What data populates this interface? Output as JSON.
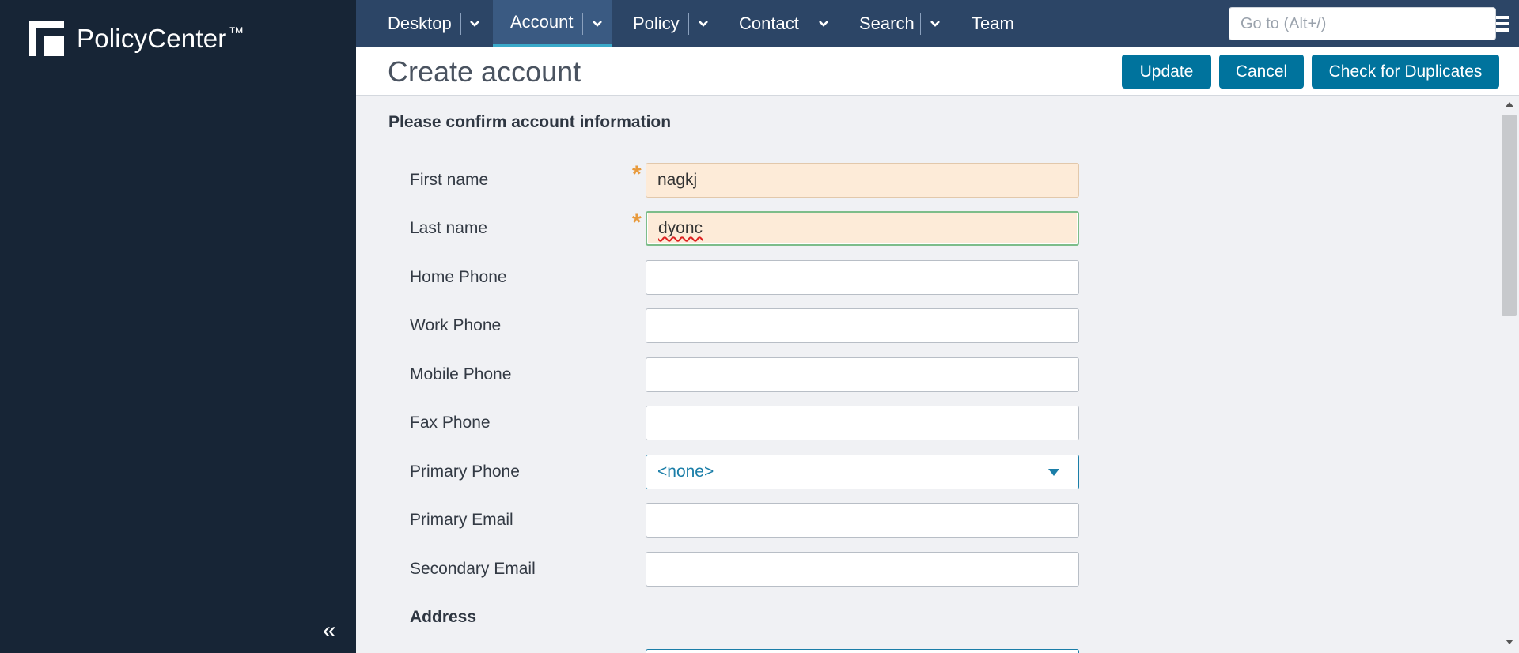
{
  "app": {
    "name": "PolicyCenter",
    "trademark": "™"
  },
  "nav": {
    "items": [
      {
        "label": "Desktop",
        "has_menu": true,
        "active": false
      },
      {
        "label": "Account",
        "has_menu": true,
        "active": true
      },
      {
        "label": "Policy",
        "has_menu": true,
        "active": false
      },
      {
        "label": "Contact",
        "has_menu": true,
        "active": false
      },
      {
        "label": "Search",
        "has_menu": true,
        "active": false
      },
      {
        "label": "Team",
        "has_menu": false,
        "active": false
      }
    ],
    "goto_placeholder": "Go to (Alt+/)",
    "icons": [
      "menu-icon",
      "bookmark-icon",
      "gear-icon"
    ]
  },
  "header": {
    "title": "Create account",
    "buttons": {
      "update": "Update",
      "cancel": "Cancel",
      "check_duplicates": "Check for Duplicates"
    }
  },
  "form": {
    "section_title": "Please confirm account information",
    "fields": {
      "first_name": {
        "label": "First name",
        "value": "nagkj",
        "required": true
      },
      "last_name": {
        "label": "Last name",
        "value": "dyonc",
        "required": true
      },
      "home_phone": {
        "label": "Home Phone",
        "value": ""
      },
      "work_phone": {
        "label": "Work Phone",
        "value": ""
      },
      "mobile_phone": {
        "label": "Mobile Phone",
        "value": ""
      },
      "fax_phone": {
        "label": "Fax Phone",
        "value": ""
      },
      "primary_phone": {
        "label": "Primary Phone",
        "value": "<none>"
      },
      "primary_email": {
        "label": "Primary Email",
        "value": ""
      },
      "secondary_email": {
        "label": "Secondary Email",
        "value": ""
      }
    },
    "required_marker": "*",
    "address_title": "Address"
  },
  "sidebar": {
    "collapse_glyph": "«"
  },
  "colors": {
    "sidebar_bg": "#172536",
    "nav_bg": "#2c4566",
    "nav_active_bg": "#3a5a82",
    "nav_active_underline": "#3aa9c9",
    "button_bg": "#00739d",
    "required_field_bg": "#fdebd8",
    "required_marker": "#e89a3c",
    "bookmark": "#6cc04a"
  }
}
